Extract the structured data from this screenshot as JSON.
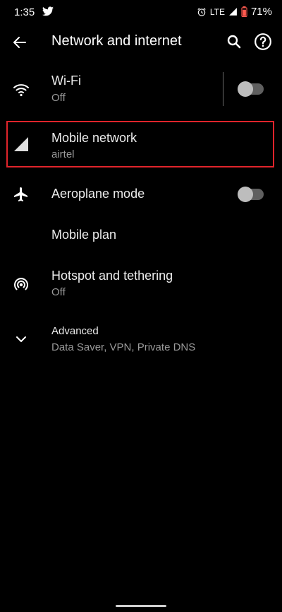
{
  "status_bar": {
    "time": "1:35",
    "network": "LTE",
    "battery": "71%",
    "icons": [
      "twitter-icon",
      "alarm-icon",
      "signal-icon",
      "battery-icon"
    ]
  },
  "app_bar": {
    "title": "Network and internet",
    "icons": [
      "back-arrow-icon",
      "search-icon",
      "help-icon"
    ]
  },
  "items": [
    {
      "label": "Wi-Fi",
      "sub": "Off",
      "icon": "wifi-icon",
      "toggle": "off"
    },
    {
      "label": "Mobile network",
      "sub": "airtel",
      "icon": "cell-signal-icon",
      "highlighted": true,
      "highlight_color": "#e0242b"
    },
    {
      "label": "Aeroplane mode",
      "icon": "airplane-icon",
      "toggle": "off"
    },
    {
      "label": "Mobile plan"
    },
    {
      "label": "Hotspot and tethering",
      "sub": "Off",
      "icon": "hotspot-icon"
    },
    {
      "label": "Advanced",
      "sub": "Data Saver, VPN, Private DNS",
      "icon": "chevron-down-icon"
    }
  ]
}
